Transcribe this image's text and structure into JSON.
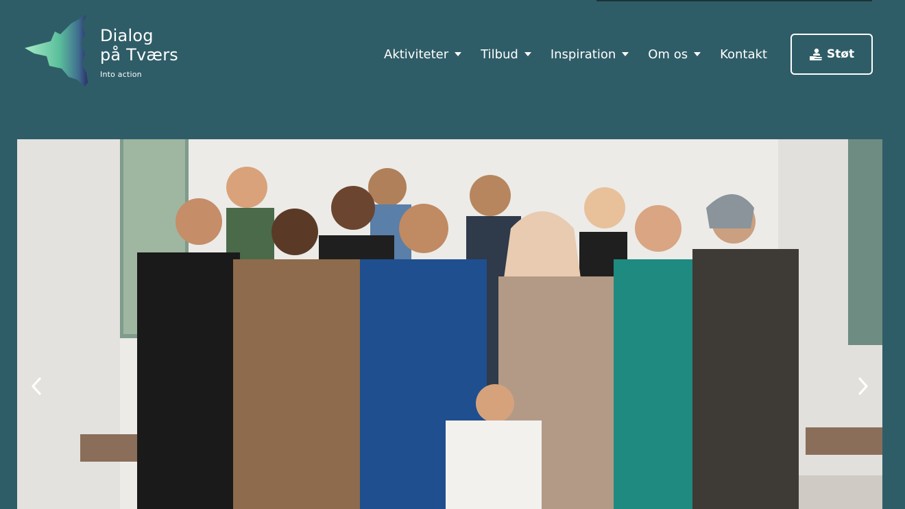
{
  "brand": {
    "name_line1": "Dialog",
    "name_line2": "på Tværs",
    "tagline": "Into action",
    "gradient_colors": [
      "#7fd9b0",
      "#3d6e9a",
      "#2a2f6b"
    ]
  },
  "nav": {
    "items": [
      {
        "label": "Aktiviteter",
        "has_dropdown": true
      },
      {
        "label": "Tilbud",
        "has_dropdown": true
      },
      {
        "label": "Inspiration",
        "has_dropdown": true
      },
      {
        "label": "Om os",
        "has_dropdown": true
      },
      {
        "label": "Kontakt",
        "has_dropdown": false
      }
    ]
  },
  "cta": {
    "label": "Støt",
    "icon": "hand-person-icon"
  },
  "hero": {
    "image_alt": "Group photo of thirteen people standing in a corridor",
    "prev_icon": "chevron-left-icon",
    "next_icon": "chevron-right-icon"
  },
  "colors": {
    "background": "#2f5d67",
    "text": "#ffffff"
  }
}
